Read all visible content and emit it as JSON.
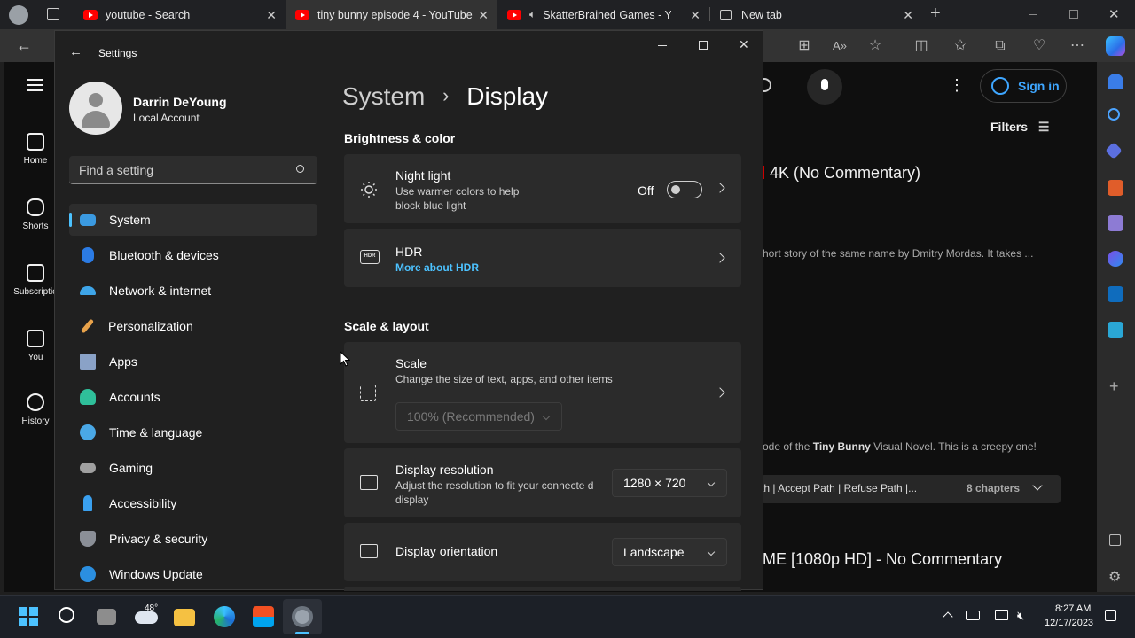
{
  "browser": {
    "tabs": [
      {
        "title": "youtube - Search",
        "active": false
      },
      {
        "title": "tiny bunny episode 4 - YouTube",
        "active": true
      },
      {
        "title": "SkatterBrained Games - You",
        "active": false
      },
      {
        "title": "New tab",
        "active": false
      }
    ],
    "new_tab_glyph": "+"
  },
  "youtube": {
    "nav": [
      {
        "label": "Home"
      },
      {
        "label": "Shorts"
      },
      {
        "label": "Subscriptio"
      },
      {
        "label": "You"
      },
      {
        "label": "History"
      }
    ],
    "sign_in": "Sign in",
    "filters": "Filters",
    "video1_title": "4K (No Commentary)",
    "video1_desc": "hort story of the same name by Dmitry Mordas. It takes ...",
    "video2_desc_prefix": "ode of the ",
    "video2_desc_bold": "Tiny Bunny",
    "video2_desc_suffix": " Visual Novel. This is a creepy one!",
    "chapters_path": "th | Accept Path | Refuse Path |...",
    "chapters_count": "8 chapters",
    "video3_title": "ME [1080p HD] - No Commentary"
  },
  "settings": {
    "app_title": "Settings",
    "user_name": "Darrin DeYoung",
    "account_type": "Local Account",
    "search_placeholder": "Find a setting",
    "nav": [
      {
        "label": "System",
        "icon": "system-icon",
        "color": "#3b9ae1"
      },
      {
        "label": "Bluetooth & devices",
        "icon": "bluetooth-icon",
        "color": "#2b7be4"
      },
      {
        "label": "Network & internet",
        "icon": "network-icon",
        "color": "#3ea5e8"
      },
      {
        "label": "Personalization",
        "icon": "brush-icon",
        "color": "#e8a24a"
      },
      {
        "label": "Apps",
        "icon": "apps-icon",
        "color": "#8aa2c7"
      },
      {
        "label": "Accounts",
        "icon": "accounts-icon",
        "color": "#2fbf9a"
      },
      {
        "label": "Time & language",
        "icon": "globe-icon",
        "color": "#4aa8e6"
      },
      {
        "label": "Gaming",
        "icon": "gaming-icon",
        "color": "#a0a0a0"
      },
      {
        "label": "Accessibility",
        "icon": "accessibility-icon",
        "color": "#3aa0ef"
      },
      {
        "label": "Privacy & security",
        "icon": "shield-icon",
        "color": "#8b8f97"
      },
      {
        "label": "Windows Update",
        "icon": "update-icon",
        "color": "#2b8fe0"
      }
    ],
    "breadcrumb_parent": "System",
    "breadcrumb_sep": "›",
    "page_title": "Display",
    "section_brightness": "Brightness & color",
    "night_light_title": "Night light",
    "night_light_desc": "Use warmer colors to help block blue light",
    "night_light_state": "Off",
    "hdr_title": "HDR",
    "hdr_link": "More about HDR",
    "section_scale": "Scale & layout",
    "scale_title": "Scale",
    "scale_desc": "Change the size of text, apps, and other items",
    "scale_value": "100% (Recommended)",
    "resolution_title": "Display resolution",
    "resolution_desc": "Adjust the resolution to fit your connecte d display",
    "resolution_value": "1280 × 720",
    "orientation_title": "Display orientation",
    "orientation_value": "Landscape",
    "accent_color": "#4cc2ff"
  },
  "taskbar": {
    "weather_temp": "48°",
    "time": "8:27 AM",
    "date": "12/17/2023"
  }
}
